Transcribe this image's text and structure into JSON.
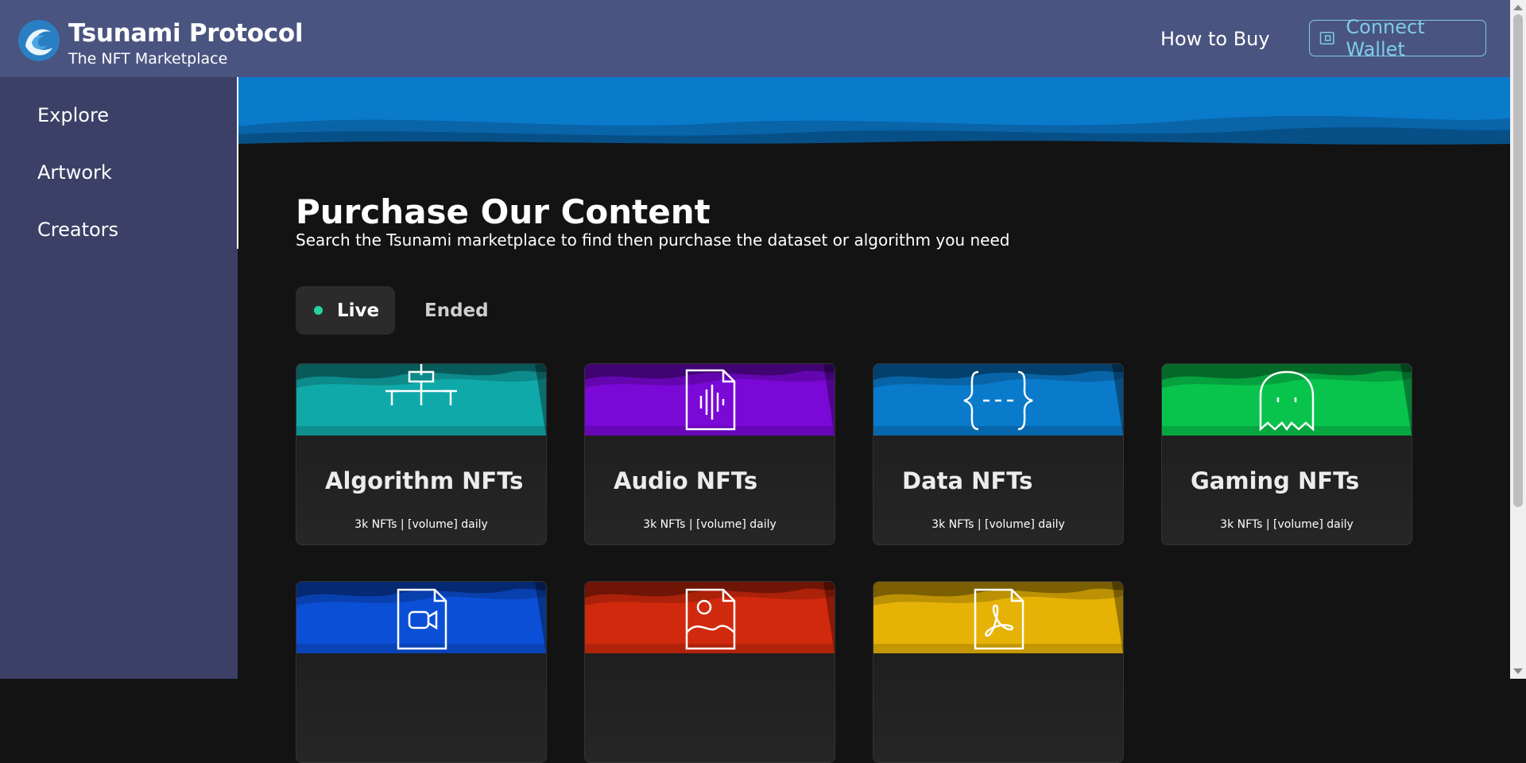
{
  "header": {
    "title": "Tsunami Protocol",
    "subtitle": "The NFT Marketplace",
    "how_to_buy": "How to Buy",
    "connect_wallet": "Connect Wallet"
  },
  "sidebar": {
    "items": [
      {
        "label": "Explore"
      },
      {
        "label": "Artwork"
      },
      {
        "label": "Creators"
      }
    ]
  },
  "main": {
    "title": "Purchase Our Content",
    "subtitle": "Search the Tsunami marketplace to find then purchase the dataset or algorithm you need",
    "tabs": [
      {
        "label": "Live",
        "active": true
      },
      {
        "label": "Ended",
        "active": false
      }
    ],
    "cards": [
      {
        "title": "Algorithm NFTs",
        "meta": "3k NFTs | [volume] daily",
        "color": "#10a9a9",
        "icon": "algorithm-icon"
      },
      {
        "title": "Audio NFTs",
        "meta": "3k NFTs | [volume] daily",
        "color": "#7a08d6",
        "icon": "audio-file-icon"
      },
      {
        "title": "Data NFTs",
        "meta": "3k NFTs | [volume] daily",
        "color": "#0a7acb",
        "icon": "code-braces-icon"
      },
      {
        "title": "Gaming NFTs",
        "meta": "3k NFTs | [volume] daily",
        "color": "#08c44c",
        "icon": "ghost-icon"
      },
      {
        "title": "",
        "meta": "",
        "color": "#0b4fd6",
        "icon": "video-file-icon"
      },
      {
        "title": "",
        "meta": "",
        "color": "#d1290d",
        "icon": "image-file-icon"
      },
      {
        "title": "",
        "meta": "",
        "color": "#e6b205",
        "icon": "pdf-file-icon"
      }
    ]
  },
  "colors": {
    "header_bg": "#4a5480",
    "sidebar_bg": "#3c4066",
    "accent": "#7ecbe8",
    "live_dot": "#25d4a4"
  }
}
